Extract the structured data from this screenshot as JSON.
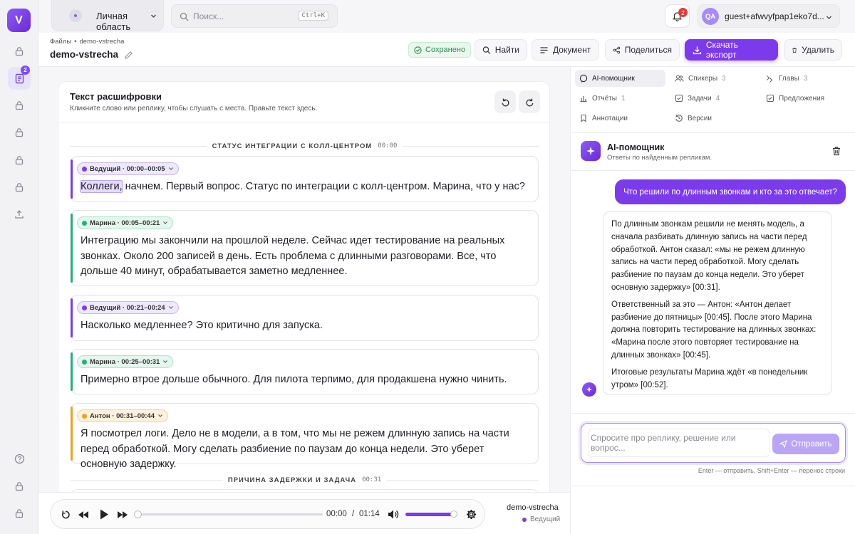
{
  "rail": {
    "logo": "V",
    "docs_badge": "2"
  },
  "topbar": {
    "workspace": "Личная область",
    "search_placeholder": "Поиск...",
    "search_shortcut": "Ctrl+K",
    "notifications_count": "2",
    "user_initials": "QA",
    "user_name": "guest+afwvyfpap1eko7d..."
  },
  "header": {
    "breadcrumb_root": "Файлы",
    "breadcrumb_sep": "•",
    "breadcrumb_current": "demo-vstrecha",
    "title": "demo-vstrecha",
    "saved": "Сохранено",
    "find": "Найти",
    "document": "Документ",
    "share": "Поделиться",
    "export": "Скачать экспорт",
    "delete": "Удалить"
  },
  "transcript": {
    "title": "Текст расшифровки",
    "subtitle": "Кликните слово или реплику, чтобы слушать с места. Правьте текст здесь.",
    "sections": [
      {
        "title": "СТАТУС ИНТЕГРАЦИИ С КОЛЛ-ЦЕНТРОМ",
        "time": "00:00"
      },
      {
        "title": "ПРИЧИНА ЗАДЕРЖКИ И ЗАДАЧА",
        "time": "00:31"
      }
    ],
    "segments": [
      {
        "speaker": "Ведущий · 00:00–00:05",
        "highlight": "Коллеги,",
        "text": " начнем. Первый вопрос. Статус по интеграции с колл-центром. Марина, что у нас?",
        "color": "#7c3aed",
        "bg": "#eee8fd",
        "border": "#c9b8f8"
      },
      {
        "speaker": "Марина · 00:05–00:21",
        "text": "Интеграцию мы закончили на прошлой неделе. Сейчас идет тестирование на реальных звонках. Около 200 записей в день. Есть проблема с длинными разговорами. Все, что дольше 40 минут, обрабатывается заметно медленнее.",
        "color": "#22b07d",
        "bg": "#e4f6ee",
        "border": "#aee3c9"
      },
      {
        "speaker": "Ведущий · 00:21–00:24",
        "text": "Насколько медленнее? Это критично для запуска.",
        "color": "#7c3aed",
        "bg": "#eee8fd",
        "border": "#c9b8f8"
      },
      {
        "speaker": "Марина · 00:25–00:31",
        "text": "Примерно втрое дольше обычного. Для пилота терпимо, для продакшена нужно чинить.",
        "color": "#22b07d",
        "bg": "#e4f6ee",
        "border": "#aee3c9"
      },
      {
        "speaker": "Антон · 00:31–00:44",
        "text": "Я посмотрел логи. Дело не в модели, а в том, что мы не режем длинную запись на части перед обработкой. Могу сделать разбиение по паузам до конца недели. Это уберет основную задержку.",
        "color": "#f0a020",
        "bg": "#fdf1dc",
        "border": "#f3d59b"
      }
    ]
  },
  "player": {
    "current": "00:00",
    "sep": "/",
    "duration": "01:14",
    "progress": 0,
    "volume": 0.95,
    "file": "demo-vstrecha",
    "speaker": "Ведущий"
  },
  "panel": {
    "tabs": [
      {
        "label": "AI-помощник",
        "count": ""
      },
      {
        "label": "Спикеры",
        "count": "3"
      },
      {
        "label": "Главы",
        "count": "3"
      },
      {
        "label": "Отчёты",
        "count": "1"
      },
      {
        "label": "Задачи",
        "count": "4"
      },
      {
        "label": "Предложения",
        "count": ""
      },
      {
        "label": "Аннотации",
        "count": ""
      },
      {
        "label": "Версии",
        "count": ""
      }
    ],
    "assistant_title": "AI-помощник",
    "assistant_subtitle": "Ответы по найденным репликам.",
    "user_message": "Что решили по длинным звонкам и кто за это отвечает?",
    "answer": [
      "По длинным звонкам решили не менять модель, а сначала разбивать длинную запись на части перед обработкой. Антон сказал: «мы не режем длинную запись на части перед обработкой. Могу сделать разбиение по паузам до конца недели. Это уберет основную задержку» [00:31].",
      "Ответственный за это — Антон: «Антон делает разбиение до пятницы» [00:45]. После этого Марина должна повторить тестирование на длинных звонках: «Марина после этого повторяет тестирование на длинных звонках» [00:45].",
      "Итоговые результаты Марина ждёт «в понедельник утром» [00:52]."
    ],
    "input_placeholder": "Спросите про реплику, решение или вопрос...",
    "send": "Отправить",
    "hint": "Enter — отправить, Shift+Enter — перенос строки"
  }
}
